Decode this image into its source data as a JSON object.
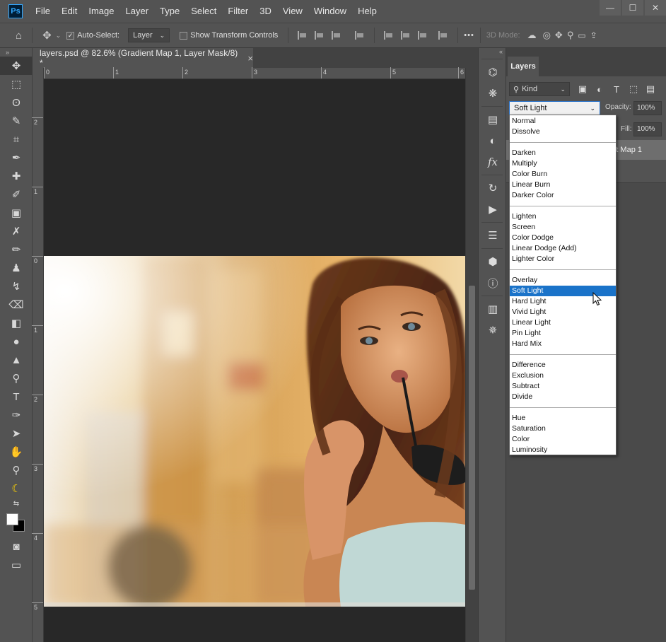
{
  "app": {
    "logo": "Ps"
  },
  "menubar": {
    "items": [
      "File",
      "Edit",
      "Image",
      "Layer",
      "Type",
      "Select",
      "Filter",
      "3D",
      "View",
      "Window",
      "Help"
    ]
  },
  "window_controls": {
    "minimize": "—",
    "maximize": "☐",
    "close": "✕"
  },
  "options": {
    "auto_select_label": "Auto-Select:",
    "auto_select_checked": true,
    "auto_select_target": "Layer",
    "show_transform_label": "Show Transform Controls",
    "show_transform_checked": false,
    "more_label": "•••",
    "mode_3d_label": "3D Mode:"
  },
  "document": {
    "tab_title": "layers.psd @ 82.6% (Gradient Map 1, Layer Mask/8) *",
    "close_glyph": "×",
    "ruler_top_labels": [
      "0",
      "1",
      "2",
      "3",
      "4",
      "5",
      "6"
    ],
    "ruler_left_labels": [
      "2",
      "1",
      "0",
      "1",
      "2",
      "3",
      "4",
      "5"
    ]
  },
  "tools": [
    "move-tool",
    "marquee-tool",
    "lasso-tool",
    "quick-select-tool",
    "crop-tool",
    "eyedropper-tool",
    "healing-brush-tool",
    "brush-tool",
    "clone-stamp-tool",
    "history-brush-tool",
    "pencil-tool",
    "stamp-tool",
    "smudge-tool",
    "eraser-tool",
    "gradient-tool",
    "blur-tool",
    "sharpen-tool",
    "dodge-tool",
    "type-tool",
    "pen-tool",
    "path-select-tool",
    "hand-tool",
    "zoom-tool",
    "banana-tool"
  ],
  "layers_panel": {
    "tab_label": "Layers",
    "kind_label": "Kind",
    "blend_mode": "Soft Light",
    "opacity_label": "Opacity:",
    "opacity_value": "100%",
    "fill_label": "Fill:",
    "fill_value": "100%",
    "layer_name_partial": "nt Map 1"
  },
  "blend_menu": {
    "groups": [
      [
        "Normal",
        "Dissolve"
      ],
      [
        "Darken",
        "Multiply",
        "Color Burn",
        "Linear Burn",
        "Darker Color"
      ],
      [
        "Lighten",
        "Screen",
        "Color Dodge",
        "Linear Dodge (Add)",
        "Lighter Color"
      ],
      [
        "Overlay",
        "Soft Light",
        "Hard Light",
        "Vivid Light",
        "Linear Light",
        "Pin Light",
        "Hard Mix"
      ],
      [
        "Difference",
        "Exclusion",
        "Subtract",
        "Divide"
      ],
      [
        "Hue",
        "Saturation",
        "Color",
        "Luminosity"
      ]
    ],
    "selected": "Soft Light"
  },
  "colors": {
    "ui_bg": "#535353",
    "selection": "#1a73c9",
    "accent": "#31a8ff"
  }
}
